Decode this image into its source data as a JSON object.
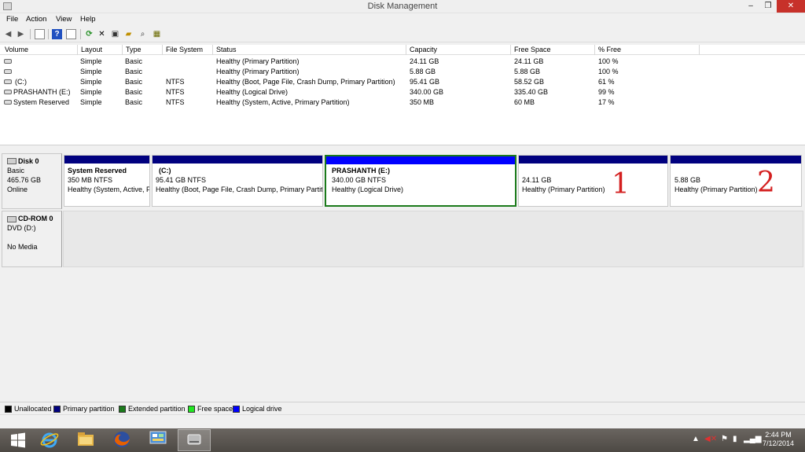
{
  "window": {
    "title": "Disk Management",
    "min": "–",
    "max": "❐",
    "close": "✕"
  },
  "menu": [
    "File",
    "Action",
    "View",
    "Help"
  ],
  "toolbar": {
    "icons": [
      "back-icon",
      "forward-icon",
      "console-icon",
      "help-icon",
      "properties-icon",
      "refresh-icon",
      "delete-icon",
      "new-icon",
      "open-icon",
      "search-icon",
      "settings-icon"
    ]
  },
  "columns": [
    "Volume",
    "Layout",
    "Type",
    "File System",
    "Status",
    "Capacity",
    "Free Space",
    "% Free"
  ],
  "volumes": [
    {
      "volume": "",
      "layout": "Simple",
      "type": "Basic",
      "fs": "",
      "status": "Healthy (Primary Partition)",
      "capacity": "24.11 GB",
      "free": "24.11 GB",
      "pct": "100 %"
    },
    {
      "volume": "",
      "layout": "Simple",
      "type": "Basic",
      "fs": "",
      "status": "Healthy (Primary Partition)",
      "capacity": "5.88 GB",
      "free": "5.88 GB",
      "pct": "100 %"
    },
    {
      "volume": "(C:)",
      "layout": "Simple",
      "type": "Basic",
      "fs": "NTFS",
      "status": "Healthy (Boot, Page File, Crash Dump, Primary Partition)",
      "capacity": "95.41 GB",
      "free": "58.52 GB",
      "pct": "61 %"
    },
    {
      "volume": "PRASHANTH (E:)",
      "layout": "Simple",
      "type": "Basic",
      "fs": "NTFS",
      "status": "Healthy (Logical Drive)",
      "capacity": "340.00 GB",
      "free": "335.40 GB",
      "pct": "99 %"
    },
    {
      "volume": "System Reserved",
      "layout": "Simple",
      "type": "Basic",
      "fs": "NTFS",
      "status": "Healthy (System, Active, Primary Partition)",
      "capacity": "350 MB",
      "free": "60 MB",
      "pct": "17 %"
    }
  ],
  "disk0": {
    "name": "Disk 0",
    "type": "Basic",
    "size": "465.76 GB",
    "state": "Online"
  },
  "partitions": [
    {
      "name": "System Reserved",
      "size": "350 MB NTFS",
      "status": "Healthy (System, Active, P",
      "color": "#00007f"
    },
    {
      "name": "(C:)",
      "size": "95.41 GB NTFS",
      "status": "Healthy (Boot, Page File, Crash Dump, Primary Partiti",
      "color": "#00007f"
    },
    {
      "name": "PRASHANTH  (E:)",
      "size": "340.00 GB NTFS",
      "status": "Healthy (Logical Drive)",
      "color": "#0000ff"
    },
    {
      "name": "",
      "size": "24.11 GB",
      "status": "Healthy (Primary Partition)",
      "color": "#00007f"
    },
    {
      "name": "",
      "size": "5.88 GB",
      "status": "Healthy (Primary Partition)",
      "color": "#00007f"
    }
  ],
  "annotations": [
    "1",
    "2"
  ],
  "cdrom": {
    "name": "CD-ROM 0",
    "type": "DVD (D:)",
    "media": "No Media"
  },
  "legend": [
    {
      "label": "Unallocated",
      "color": "#000000"
    },
    {
      "label": "Primary partition",
      "color": "#00007f"
    },
    {
      "label": "Extended partition",
      "color": "#1b7a1b"
    },
    {
      "label": "Free space",
      "color": "#22e822"
    },
    {
      "label": "Logical drive",
      "color": "#0000ff"
    }
  ],
  "taskbar": {
    "apps": [
      "start-icon",
      "internet-explorer-icon",
      "file-explorer-icon",
      "firefox-icon",
      "control-panel-icon",
      "disk-management-icon"
    ],
    "time": "2:44 PM",
    "date": "7/12/2014"
  }
}
